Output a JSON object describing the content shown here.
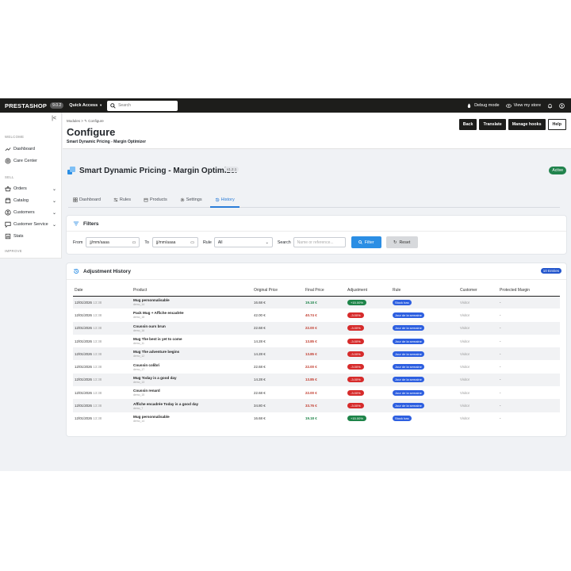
{
  "topbar": {
    "logo": "PRESTASHOP",
    "version": "9.0.2",
    "quick_access": "Quick Access",
    "search_placeholder": "Search",
    "debug": "Debug mode",
    "view_store": "View my store"
  },
  "sidebar": {
    "collapse": "|<",
    "sections": {
      "welcome": "WELCOME",
      "sell": "SELL",
      "improve": "IMPROVE"
    },
    "items": {
      "dashboard": "Dashboard",
      "care_center": "Care Center",
      "orders": "Orders",
      "catalog": "Catalog",
      "customers": "Customers",
      "customer_service": "Customer Service",
      "stats": "Stats"
    }
  },
  "header": {
    "breadcrumb_modules": "Modules",
    "breadcrumb_sep": ">",
    "breadcrumb_configure": "Configure",
    "title": "Configure",
    "subtitle": "Smart Dynamic Pricing - Margin Optimizer",
    "buttons": {
      "back": "Back",
      "translate": "Translate",
      "manage_hooks": "Manage hooks",
      "help": "Help"
    }
  },
  "module": {
    "title": "Smart Dynamic Pricing - Margin Optimizer",
    "version": "v1.2.1",
    "status": "Active"
  },
  "tabs": [
    "Dashboard",
    "Rules",
    "Products",
    "Settings",
    "History"
  ],
  "filters": {
    "title": "Filters",
    "from_label": "From",
    "from_value": "jj/mm/aaaa",
    "to_label": "To",
    "to_value": "jj/mm/aaaa",
    "rule_label": "Rule",
    "rule_value": "All",
    "search_label": "Search",
    "search_placeholder": "Name or reference...",
    "filter_button": "Filter",
    "reset_button": "Reset"
  },
  "history": {
    "title": "Adjustment History",
    "entries": "10 Entries",
    "columns": [
      "Date",
      "Product",
      "Original Price",
      "Final Price",
      "Adjustment",
      "Rule",
      "Customer",
      "Protected Margin"
    ],
    "rows": [
      {
        "date": "12/01/2026",
        "time": "13:38",
        "product": "Mug personnalisable",
        "ref": "demo_14",
        "original": "16.68 €",
        "final": "19.18 €",
        "dir": "up",
        "adjustment": "+15.00%",
        "rule": "Stock bas",
        "customer": "Visitor",
        "margin": "-"
      },
      {
        "date": "12/01/2026",
        "time": "13:38",
        "product": "Pack Mug + Affiche encadrée",
        "ref": "demo_18",
        "original": "42.00 €",
        "final": "40.74 €",
        "dir": "down",
        "adjustment": "-3.00%",
        "rule": "Jour de la semaine",
        "customer": "Visitor",
        "margin": "-"
      },
      {
        "date": "12/01/2026",
        "time": "13:38",
        "product": "Coussin ours brun",
        "ref": "demo_16",
        "original": "22.68 €",
        "final": "22.00 €",
        "dir": "down",
        "adjustment": "-3.00%",
        "rule": "Jour de la semaine",
        "customer": "Visitor",
        "margin": "-"
      },
      {
        "date": "12/01/2026",
        "time": "13:38",
        "product": "Mug The best is yet to come",
        "ref": "demo_11",
        "original": "14.28 €",
        "final": "13.85 €",
        "dir": "down",
        "adjustment": "-3.00%",
        "rule": "Jour de la semaine",
        "customer": "Visitor",
        "margin": "-"
      },
      {
        "date": "12/01/2026",
        "time": "13:38",
        "product": "Mug The adventure begins",
        "ref": "demo_12",
        "original": "14.28 €",
        "final": "13.85 €",
        "dir": "down",
        "adjustment": "-3.00%",
        "rule": "Jour de la semaine",
        "customer": "Visitor",
        "margin": "-"
      },
      {
        "date": "12/01/2026",
        "time": "13:38",
        "product": "Coussin colibri",
        "ref": "demo_17",
        "original": "22.68 €",
        "final": "22.00 €",
        "dir": "down",
        "adjustment": "-3.00%",
        "rule": "Jour de la semaine",
        "customer": "Visitor",
        "margin": "-"
      },
      {
        "date": "12/01/2026",
        "time": "13:38",
        "product": "Mug Today is a good day",
        "ref": "demo_13",
        "original": "14.28 €",
        "final": "13.85 €",
        "dir": "down",
        "adjustment": "-3.00%",
        "rule": "Jour de la semaine",
        "customer": "Visitor",
        "margin": "-"
      },
      {
        "date": "12/01/2026",
        "time": "13:38",
        "product": "Coussin renard",
        "ref": "demo_15",
        "original": "22.68 €",
        "final": "22.00 €",
        "dir": "down",
        "adjustment": "-3.00%",
        "rule": "Jour de la semaine",
        "customer": "Visitor",
        "margin": "-"
      },
      {
        "date": "12/01/2026",
        "time": "13:38",
        "product": "Affiche encadrée Today is a good day",
        "ref": "demo_7",
        "original": "34.80 €",
        "final": "33.76 €",
        "dir": "down",
        "adjustment": "-3.00%",
        "rule": "Jour de la semaine",
        "customer": "Visitor",
        "margin": "-"
      },
      {
        "date": "12/01/2026",
        "time": "13:38",
        "product": "Mug personnalisable",
        "ref": "demo_14",
        "original": "16.68 €",
        "final": "19.18 €",
        "dir": "up",
        "adjustment": "+15.00%",
        "rule": "Stock bas",
        "customer": "Visitor",
        "margin": "-"
      }
    ]
  },
  "colors": {
    "topbar": "#1d1d1b",
    "accent_blue": "#2b8ee4",
    "active_green": "#21834d",
    "rule_blue": "#2d5fe0",
    "adj_up": "#1e8449",
    "adj_down": "#d62b2b"
  }
}
